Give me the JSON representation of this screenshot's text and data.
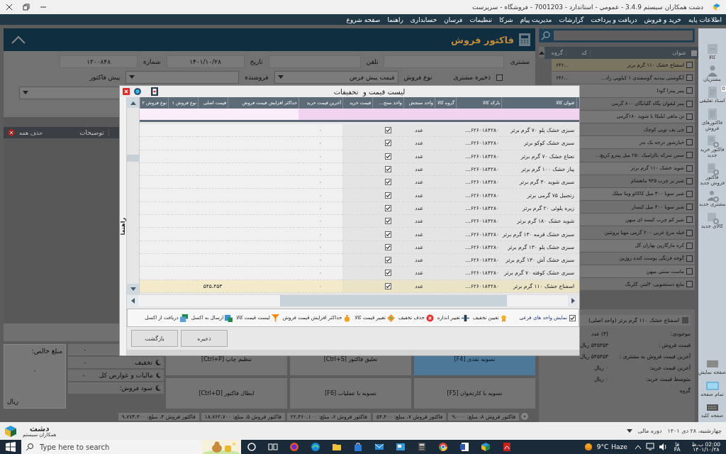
{
  "title_bar": {
    "title": "دشت همکاران سیستم 3.4.9 - عمومي - استاندارد - 7001203 - فروشگاه - سرپرست"
  },
  "menu": [
    "اطلاعات پایه",
    "خرید و فروش",
    "دریافت و پرداخت",
    "گزارشات",
    "مدیریت پیام",
    "شرکا",
    "تنظیمات",
    "فرسان",
    "حسابداری",
    "راهنما",
    "صفحه شروع"
  ],
  "invoice": {
    "title": "فاکتور فروش",
    "fields": [
      {
        "label": "مشتری"
      },
      {
        "label": "تلفن"
      },
      {
        "label": "تاریخ",
        "value": "۱۴۰۱/۱۰/۲۸"
      },
      {
        "label": "شماره",
        "value": "۱۳۰۰۸۴۸"
      }
    ],
    "save_customer": {
      "label": "ذخیره مشتری",
      "checked": false
    },
    "sale_type": {
      "label": "نوع فروش",
      "value": "قیمت پیش فرض"
    },
    "seller": {
      "label": "فروشنده"
    },
    "pre_invoice": {
      "label": "پیش فاکتور"
    },
    "items_header": {
      "description": "توضیحات",
      "delete_all": "حذف همه"
    },
    "net": {
      "label": "مبلغ خالص:",
      "value": "۰",
      "unit": "ریال"
    },
    "totals": [
      {
        "value": "۰"
      },
      {
        "label": "تخفیف",
        "value": "۰"
      },
      {
        "label": "مالیات و عوارض کل",
        "value": "۰"
      },
      {
        "label": "سود فروش:"
      }
    ],
    "tiles": [
      {
        "label": "تسویه نقدی [F4]",
        "selected": true
      },
      {
        "label": "تعلیق فاکتور [Ctrl+S]",
        "selected": false
      },
      {
        "label": "تنظیم چاپ [Ctrl+P]",
        "selected": false
      },
      {
        "label": "تسویه با کارتخوان [F5]",
        "selected": false
      },
      {
        "label": "تسویه با عملیات [F6]",
        "selected": false
      },
      {
        "label": "ابطال فاکتور [Ctrl+D]",
        "selected": false
      }
    ],
    "tabs": [
      "فاکتور فروش ۸، مبلغ: ۹،۰۰۰",
      "فاکتور فروش ۷، مبلغ: ۵۴،۴۰۰",
      "فاکتور فروش ۶، مبلغ: ۲۲،۴۶۰،۱۰۰",
      "فاکتور فروش ۵، مبلغ: ۱۸،۷۶۲،۷۰۰",
      "فاکتور فروش ۴، مبلغ: ۹،۷۷۳،۳۰۰"
    ]
  },
  "products": {
    "columns": [
      "عنوان",
      "کد",
      "گروه"
    ],
    "rows": [
      {
        "title": "اسفناج خشک ۱۱۰ گرم برتر",
        "code": "...۶۴۶",
        "selected": true,
        "checked": false
      },
      {
        "title": "آبگوشتی بیدنبه گوسفندی ۱ کیلویی راد...",
        "code": "...۶۴۶",
        "selected": false,
        "checked": false
      },
      {
        "title": "پنیر پیتزا گودا",
        "selected": false,
        "checked": false
      },
      {
        "title": "پنیر لیقوان پگاه گلپایگان ۸۰۰ گرمی",
        "selected": false,
        "checked": false
      },
      {
        "title": "تن ماهی ایلیکا با شوید ۱۸۰گرمی",
        "selected": false,
        "checked": false
      },
      {
        "title": "چی پف توپی کوچک",
        "selected": false,
        "checked": false
      },
      {
        "title": "خیارشور درجه یک بدر",
        "selected": false,
        "checked": false
      },
      {
        "title": "سس سرکه بالزامیک ۲۵۰ میل پیترو کریچ...",
        "selected": false,
        "checked": false
      },
      {
        "title": "شوید خشک ۱۱۰ گرم برتر",
        "selected": false,
        "checked": false
      },
      {
        "title": "شیر پر چرب ۹۴۵ ماهشام",
        "selected": false,
        "checked": false
      },
      {
        "title": "شیر سویا ۳۰۰ میل کاکائو ویتا میلک",
        "selected": false,
        "checked": false
      },
      {
        "title": "شیر سویا ۳۰۰ میل کیسار",
        "selected": false,
        "checked": false
      },
      {
        "title": "شیر کم چرب کیسه ای میهن",
        "selected": false,
        "checked": false
      },
      {
        "title": "فیله مرغ عربی ۲۰۰ گرمی مهیا پروتئین",
        "selected": false,
        "checked": false
      },
      {
        "title": "کره مارگارین بهاران گل",
        "selected": false,
        "checked": false
      },
      {
        "title": "گوجه فرنگی پوست کنده روژین",
        "selected": false,
        "checked": false
      },
      {
        "title": "ماست سنتی میهن",
        "selected": false,
        "checked": false
      },
      {
        "title": "مایع دستشویی، ۴لیتر، گلرنگ",
        "selected": false,
        "checked": false
      }
    ],
    "detail_title": "اسفناج خشک ۱۱۰ گرم برتر (واحد اصلی)",
    "details": [
      {
        "label": "موجودی:",
        "value": "(۳) عدد"
      },
      {
        "label": "قیمت فروش :",
        "value": "۵۴۵۴۵۳ ریال"
      },
      {
        "label": "آخرین قیمت فروش به مشتری :",
        "value": "۵۴۵۴۵۳ ریال"
      },
      {
        "label": "آخرین قیمت خرید:",
        "value": "۰ ریال"
      },
      {
        "label": "متوسط قیمت خرید:",
        "value": "۰ ریال"
      },
      {
        "label": "گروه"
      }
    ]
  },
  "sidebar": {
    "items": [
      {
        "kind": "box",
        "label": "کالا"
      },
      {
        "kind": "person",
        "label": "مشتریان"
      },
      {
        "kind": "doc",
        "label": "اسناد تعلیقی",
        "badge": "0"
      },
      {
        "kind": "doc",
        "label": "فاکتورهای فروش"
      },
      {
        "kind": "docplus",
        "label": "فاکتور خرید جدید"
      },
      {
        "kind": "docplus",
        "label": "فاکتور فروش جدید"
      },
      {
        "kind": "personplus",
        "label": "مشتری جدید"
      },
      {
        "kind": "boxplus",
        "label": "کالای جدید"
      }
    ],
    "bottom": [
      {
        "kind": "screen",
        "label": "صفحه نمایش"
      },
      {
        "kind": "fullscreen",
        "label": "تمام صفحه"
      },
      {
        "kind": "keyboard",
        "label": "صفحه کلید"
      }
    ]
  },
  "dialog": {
    "title": "لیست قیمت و  تخفیفات",
    "side_tab": "راهنما",
    "columns": [
      "عنوان کالا",
      "بارکد کالا",
      "گروه کالا",
      "واحد سنجش",
      "واحد سنج...",
      "قیمت خرید",
      "آخرین قیمت خرید",
      "حداکثر افزایش قیمت فروش",
      "قیمت اصلی",
      "نوع فروش ۱",
      "نوع فروش ۲"
    ],
    "rows": [
      {
        "title": "سبزی خشک پلو ۷۰ گرم برتر",
        "barcode": "...۶۲۶۰۱۸۴۲۸۰",
        "unit": "عدد",
        "checked": true,
        "last_price": "۰",
        "selected": false
      },
      {
        "title": "سبزی خشک کوکو برتر",
        "barcode": "...۶۲۶۰۱۸۴۲۸۰",
        "unit": "عدد",
        "checked": true,
        "last_price": "۰",
        "selected": false
      },
      {
        "title": "نعناع خشک ۷۰ گرم برتر",
        "barcode": "...۶۲۶۰۱۸۴۲۸۰",
        "unit": "عدد",
        "checked": true,
        "last_price": "۰",
        "selected": false
      },
      {
        "title": "پیاز خشک ۱۰۰ گرم برتر",
        "barcode": "...۶۲۶۰۱۸۴۲۸۰",
        "unit": "عدد",
        "checked": true,
        "last_price": "۰",
        "selected": false
      },
      {
        "title": "سبزی شوید ۳۰ گرم برتر",
        "barcode": "...۶۲۶۰۱۸۴۲۸۰",
        "unit": "عدد",
        "checked": true,
        "last_price": "۰",
        "selected": false
      },
      {
        "title": "زنجبیل ۷۵ گرمی برتر",
        "barcode": "...۶۲۶۰۱۸۴۲۸۰",
        "unit": "عدد",
        "checked": true,
        "last_price": "۰",
        "selected": false
      },
      {
        "title": "زیره پلوئی ۲۰ گرم برتر",
        "barcode": "...۶۲۶۰۱۸۴۲۸۰",
        "unit": "عدد",
        "checked": true,
        "last_price": "۰",
        "selected": false
      },
      {
        "title": "شوید خشک ۱۸۰ گرم برتر",
        "barcode": "...۶۲۶۰۱۸۴۲۸۰",
        "unit": "عدد",
        "checked": true,
        "last_price": "۰",
        "selected": false
      },
      {
        "title": "سبزی خشک قرمه ۱۳۰ گرم برتر",
        "barcode": "...۶۲۶۰۱۸۴۲۸۰",
        "unit": "عدد",
        "checked": true,
        "last_price": "۰",
        "selected": false
      },
      {
        "title": "سبزی خشک پلو ۱۳۰ گرم برتر",
        "barcode": "...۶۲۶۰۱۸۴۲۸۰",
        "unit": "عدد",
        "checked": true,
        "last_price": "۰",
        "selected": false
      },
      {
        "title": "سبزی خشک آش ۱۳۰ گرم برتر",
        "barcode": "...۶۲۶۰۱۸۴۲۸۰",
        "unit": "عدد",
        "checked": true,
        "last_price": "۰",
        "selected": false
      },
      {
        "title": "سبزی خشک کوفته ۷۰ گرم برتر",
        "barcode": "...۶۲۶۰۱۸۴۲۸۰",
        "unit": "عدد",
        "checked": true,
        "last_price": "۰",
        "selected": false
      },
      {
        "title": "اسفناج خشک ۱۱۰ گرم برتر",
        "barcode": "...۶۲۶۰۱۸۴۲۸۰",
        "unit": "عدد",
        "checked": true,
        "last_price": "۰",
        "base_price": "۵۴۵،۴۵۳",
        "selected": true
      }
    ],
    "show_sub_units": {
      "label": "نمایش واحد های فرعی",
      "checked": true
    },
    "tools": [
      {
        "kind": "medal",
        "label": "تعیین تخفیف"
      },
      {
        "kind": "resize",
        "label": "تغییر اندازه"
      },
      {
        "kind": "remove",
        "label": "حذف تخفیف"
      },
      {
        "kind": "tag",
        "label": "تغییر قیمت کالا"
      },
      {
        "kind": "coin",
        "label": "حداکثر افزایش قیمت فروش"
      },
      {
        "kind": "filter",
        "label": "لیست قیمت کالا"
      },
      {
        "kind": "excel_out",
        "label": "ارسال به اکسل"
      },
      {
        "kind": "excel_in",
        "label": "دریافت از اکسل"
      }
    ],
    "buttons": [
      "ذخیره",
      "بازگشت"
    ]
  },
  "status": {
    "brand": "دشت",
    "brand_sub": "همکاران سیستم",
    "date": "چهارشنبه، ۲۸ دی ۱۴۰۱",
    "period": "دوره مالی"
  },
  "taskbar": {
    "search_placeholder": "Type here to search",
    "temperature": "9°C",
    "weather": "Haze",
    "lang_fa": "فا",
    "lang_en": "FA",
    "time": "02:00 ب.ظ",
    "date": "۱۴۰۱/۱۰/۲۸"
  }
}
